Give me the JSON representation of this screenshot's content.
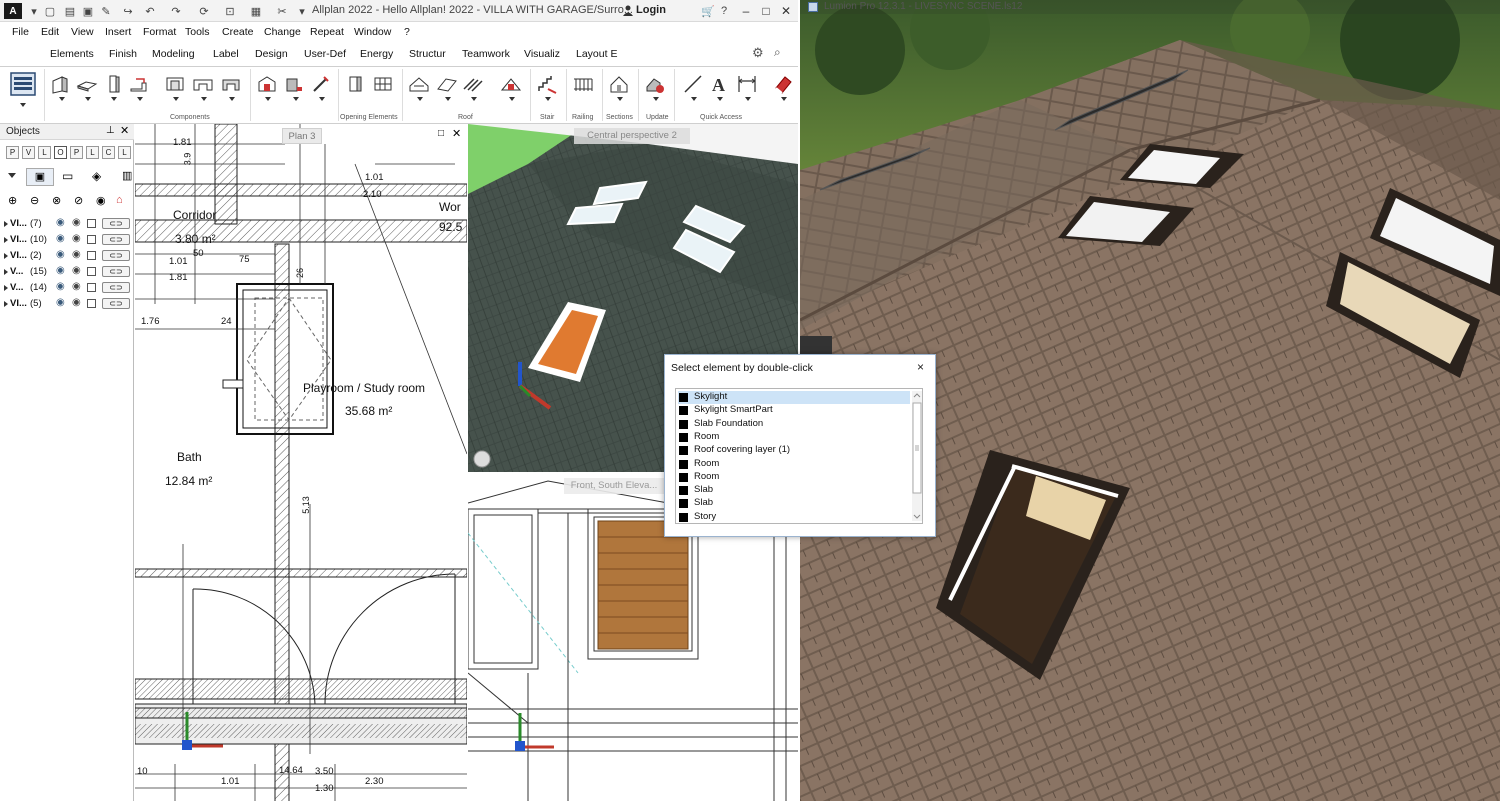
{
  "allplan": {
    "title": "Allplan 2022 - Hello Allplan! 2022 - VILLA WITH GARAGE/Surro...",
    "login_label": "Login",
    "logo": "A",
    "menu": [
      "File",
      "Edit",
      "View",
      "Insert",
      "Format",
      "Tools",
      "Create",
      "Change",
      "Repeat",
      "Window",
      "?"
    ],
    "tabs": [
      "Elements",
      "Finish",
      "Modeling",
      "Label",
      "Design",
      "User-Def",
      "Energy",
      "Structur",
      "Teamwork",
      "Visualiz",
      "Layout E"
    ],
    "active_tab": "Elements",
    "ribbon_groups": [
      "Components",
      "Opening Elements",
      "Roof",
      "Stair",
      "Railing",
      "Sections",
      "Update",
      "Quick Access"
    ],
    "objects_panel": {
      "title": "Objects",
      "filters": [
        "P",
        "V",
        "L",
        "O",
        "P",
        "L",
        "C",
        "L"
      ],
      "active_filter_index": 3,
      "rows": [
        {
          "label": "VI...",
          "count": "(7)"
        },
        {
          "label": "VI...",
          "count": "(10)"
        },
        {
          "label": "VI...",
          "count": "(2)"
        },
        {
          "label": "V...",
          "count": "(15)"
        },
        {
          "label": "V...",
          "count": "(14)"
        },
        {
          "label": "VI...",
          "count": "(5)"
        }
      ]
    },
    "viewports": {
      "plan_label": "Plan 3",
      "perspective_label": "Central perspective 2",
      "elevation_label": "Front, South Eleva..."
    },
    "plan_labels": {
      "corridor": "Corridor",
      "corridor_area": "3.80 m²",
      "playroom": "Playroom / Study room",
      "playroom_area": "35.68 m²",
      "bath": "Bath",
      "bath_area": "12.84 m²",
      "work": "Wor",
      "work_area": "92.5"
    },
    "dimensions": [
      "1.81",
      "3.9",
      "1.01",
      "2.10",
      "1.01",
      "1.81",
      "50",
      "75",
      "26",
      "1.76",
      "24",
      "5.13",
      "1.01",
      "14.64",
      "3.50",
      "1.30",
      "2.30",
      "10"
    ]
  },
  "dialog": {
    "title": "Select element by double-click",
    "close": "×",
    "items": [
      "Skylight",
      "Skylight SmartPart",
      "Slab Foundation",
      "Room",
      "Roof covering layer  (1)",
      "Room",
      "Room",
      "Slab",
      "Slab",
      "Story"
    ],
    "selected_index": 0
  },
  "lumion": {
    "title": "Lumion Pro 12.3.1 - LIVESYNC SCENE.ls12"
  },
  "colors": {
    "roof_dark": "#3e4a45",
    "roof_lumion": "#7a6657",
    "selection": "#cde3f7",
    "grass": "#7fd06a"
  }
}
